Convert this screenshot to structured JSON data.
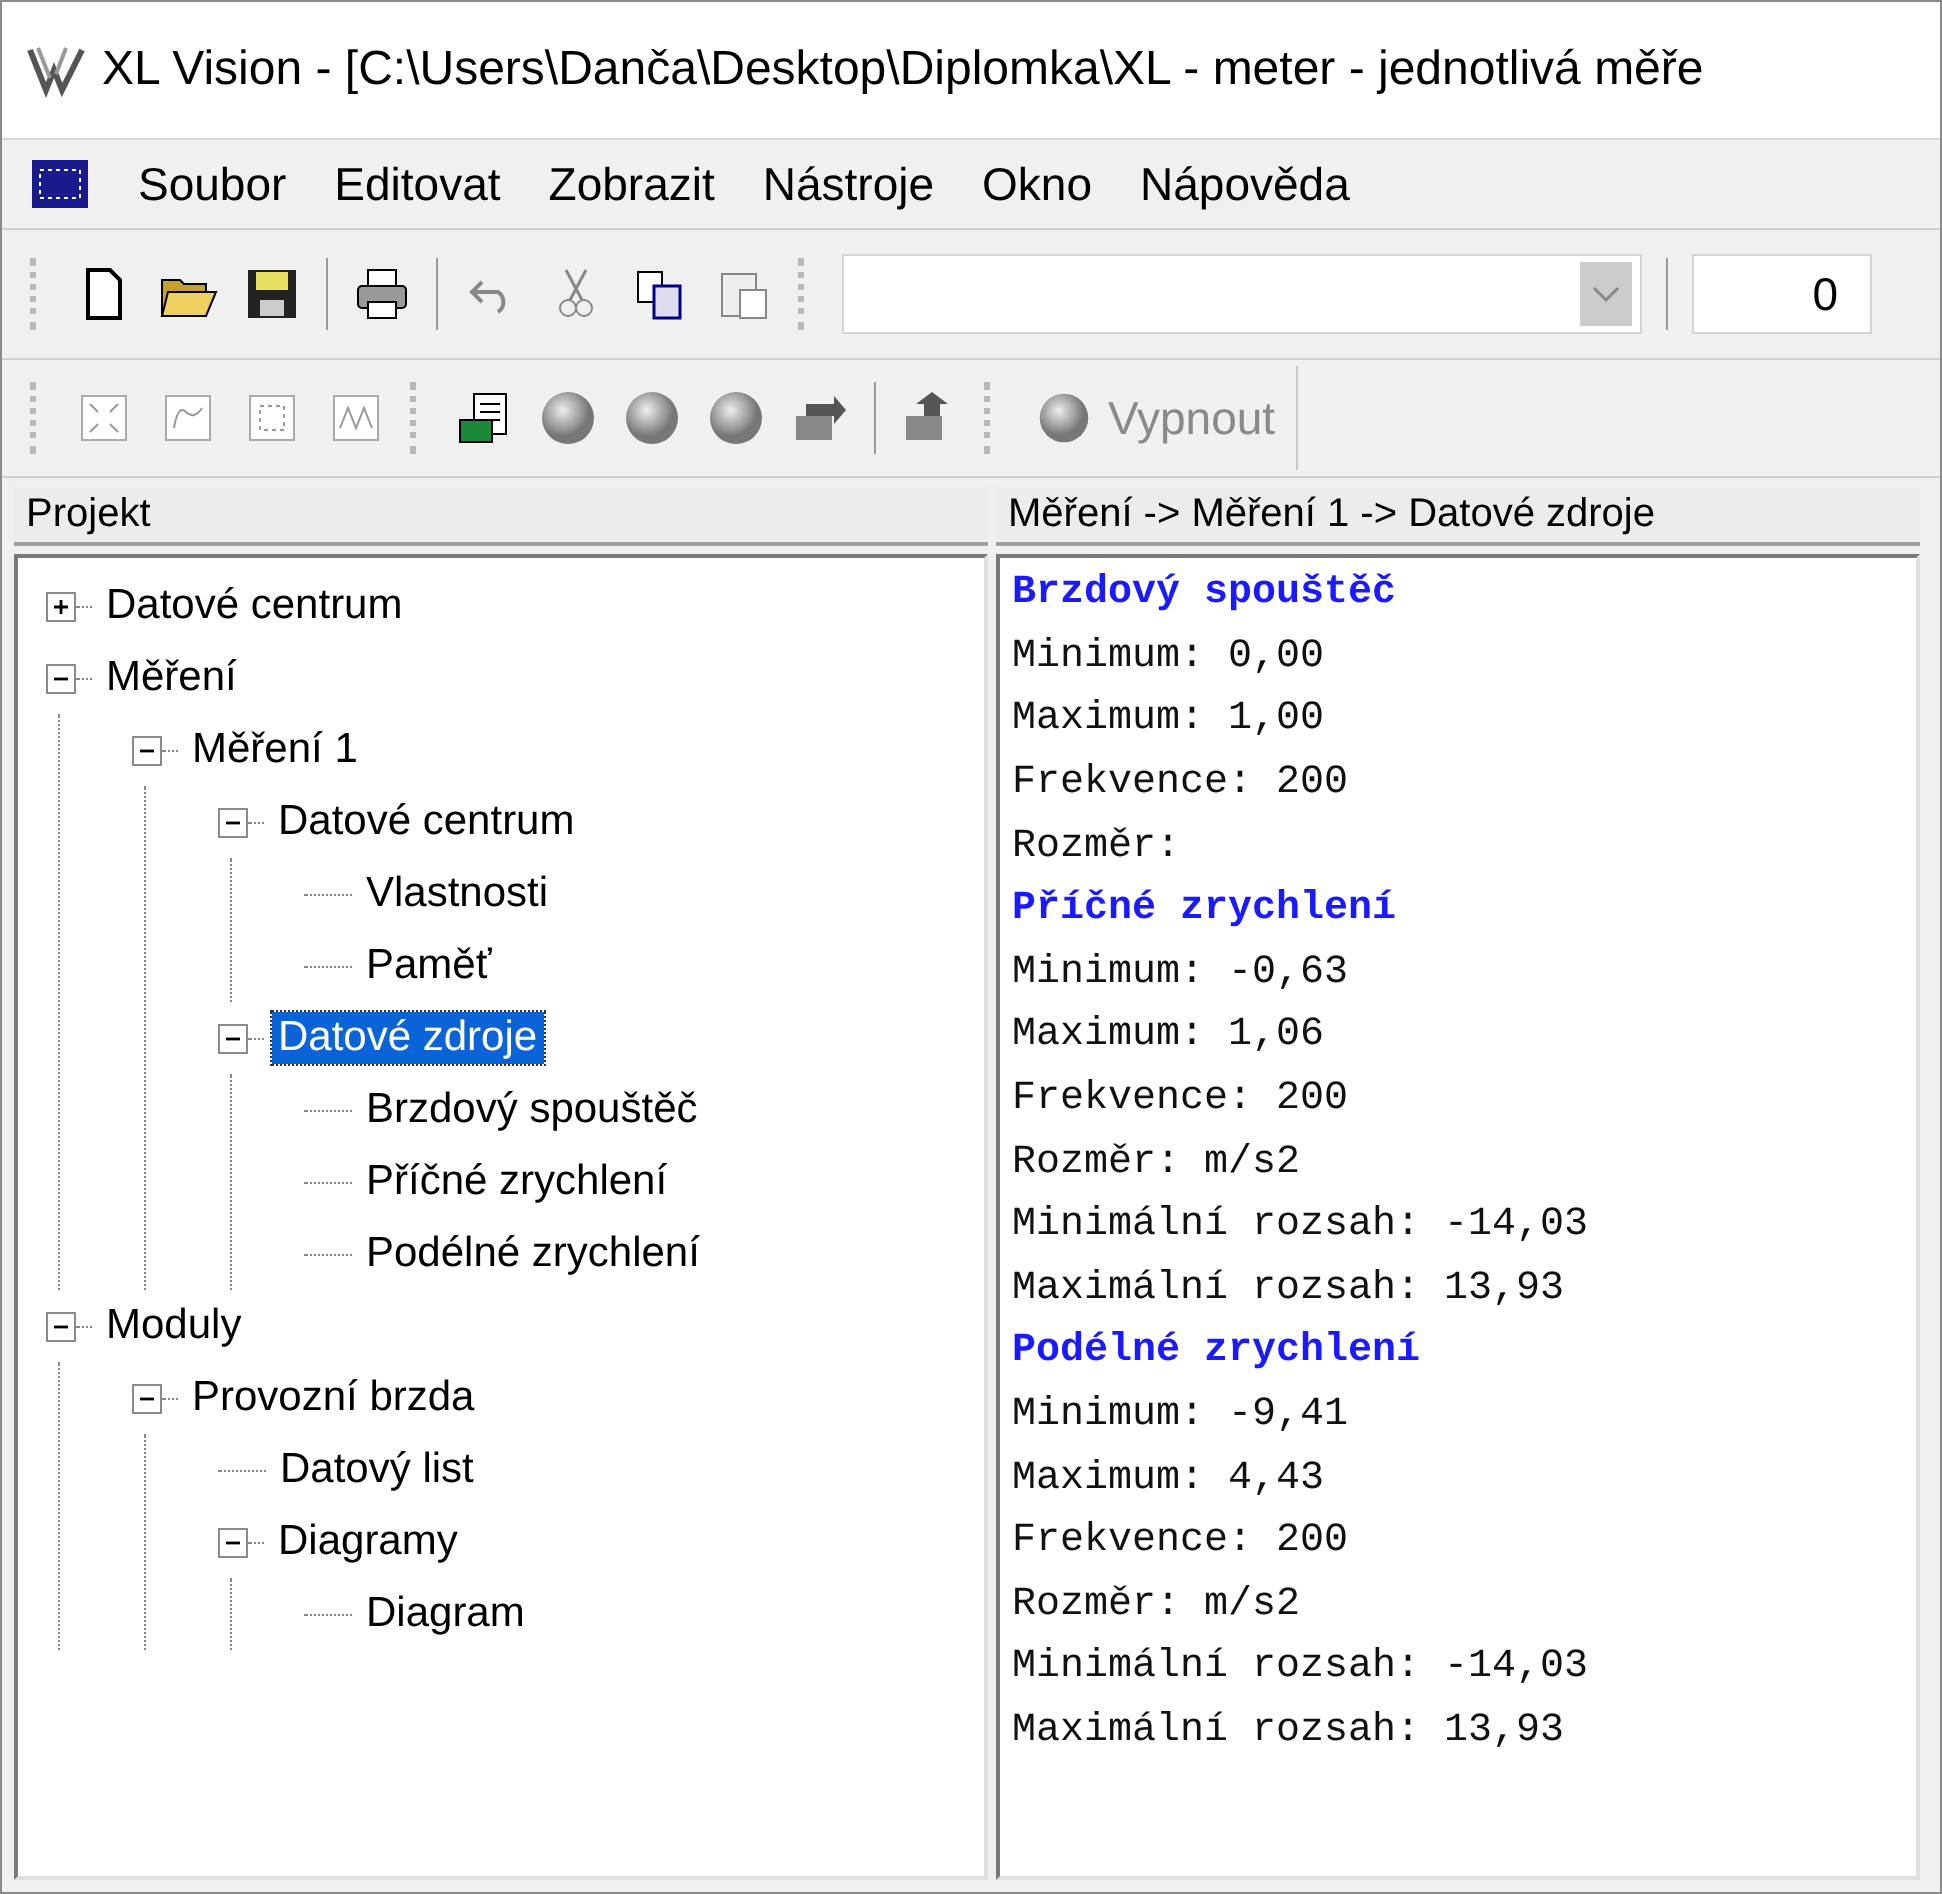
{
  "window": {
    "title": "XL Vision - [C:\\Users\\Danča\\Desktop\\Diplomka\\XL - meter - jednotlivá měře"
  },
  "menu": [
    "Soubor",
    "Editovat",
    "Zobrazit",
    "Nástroje",
    "Okno",
    "Nápověda"
  ],
  "toolbar": {
    "number_field": {
      "value": "0"
    }
  },
  "toolbar2": {
    "switch_button": {
      "label": "Vypnout",
      "disabled": true
    }
  },
  "project_panel": {
    "title": "Projekt",
    "tree": [
      {
        "label": "Datové centrum",
        "expanded": false,
        "selected": false
      },
      {
        "label": "Měření",
        "expanded": true,
        "selected": false,
        "children": [
          {
            "label": "Měření 1",
            "expanded": true,
            "selected": false,
            "children": [
              {
                "label": "Datové centrum",
                "expanded": true,
                "selected": false,
                "children": [
                  {
                    "label": "Vlastnosti",
                    "selected": false
                  },
                  {
                    "label": "Paměť",
                    "selected": false
                  }
                ]
              },
              {
                "label": "Datové zdroje",
                "expanded": true,
                "selected": true,
                "children": [
                  {
                    "label": "Brzdový spouštěč",
                    "selected": false
                  },
                  {
                    "label": "Příčné zrychlení",
                    "selected": false
                  },
                  {
                    "label": "Podélné zrychlení",
                    "selected": false
                  }
                ]
              }
            ]
          }
        ]
      },
      {
        "label": "Moduly",
        "expanded": true,
        "selected": false,
        "children": [
          {
            "label": "Provozní brzda",
            "expanded": true,
            "selected": false,
            "children": [
              {
                "label": "Datový list",
                "selected": false
              },
              {
                "label": "Diagramy",
                "expanded": true,
                "selected": false,
                "children": [
                  {
                    "label": "Diagram",
                    "selected": false
                  }
                ]
              }
            ]
          }
        ]
      }
    ]
  },
  "detail_panel": {
    "breadcrumb": "Měření -> Měření 1 -> Datové zdroje",
    "lines": [
      {
        "kind": "heading",
        "text": "Brzdový spouštěč"
      },
      {
        "kind": "line",
        "text": "Minimum: 0,00"
      },
      {
        "kind": "line",
        "text": "Maximum: 1,00"
      },
      {
        "kind": "line",
        "text": "Frekvence: 200"
      },
      {
        "kind": "line",
        "text": "Rozměr:"
      },
      {
        "kind": "heading",
        "text": "Příčné zrychlení"
      },
      {
        "kind": "line",
        "text": "Minimum: -0,63"
      },
      {
        "kind": "line",
        "text": "Maximum: 1,06"
      },
      {
        "kind": "line",
        "text": "Frekvence: 200"
      },
      {
        "kind": "line",
        "text": "Rozměr: m/s2"
      },
      {
        "kind": "line",
        "text": "Minimální rozsah: -14,03"
      },
      {
        "kind": "line",
        "text": "Maximální rozsah: 13,93"
      },
      {
        "kind": "heading",
        "text": "Podélné zrychlení"
      },
      {
        "kind": "line",
        "text": "Minimum: -9,41"
      },
      {
        "kind": "line",
        "text": "Maximum: 4,43"
      },
      {
        "kind": "line",
        "text": "Frekvence: 200"
      },
      {
        "kind": "line",
        "text": "Rozměr: m/s2"
      },
      {
        "kind": "line",
        "text": "Minimální rozsah: -14,03"
      },
      {
        "kind": "line",
        "text": "Maximální rozsah: 13,93"
      }
    ]
  }
}
